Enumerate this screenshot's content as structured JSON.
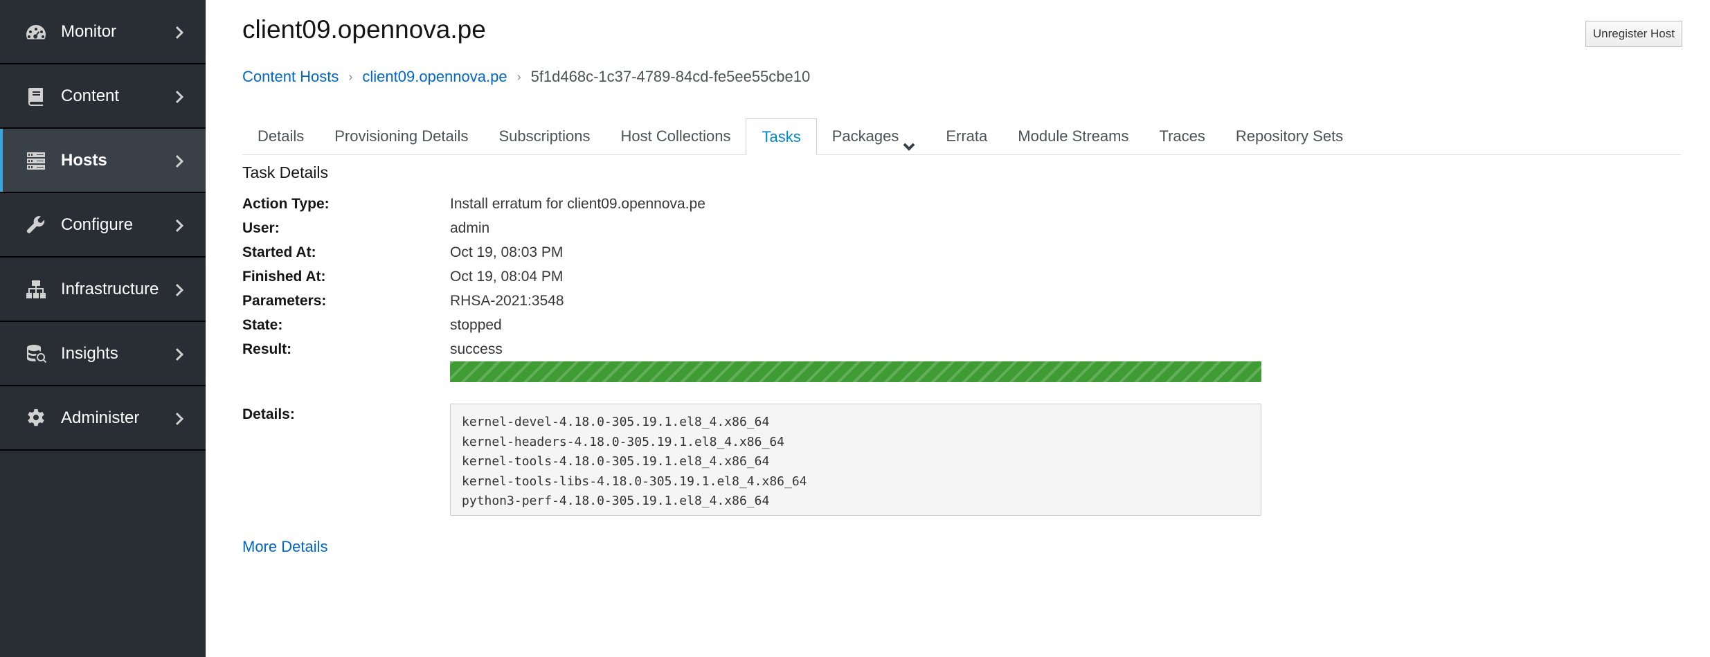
{
  "sidebar": {
    "items": [
      {
        "label": "Monitor",
        "icon": "dashboard-icon",
        "active": false
      },
      {
        "label": "Content",
        "icon": "book-icon",
        "active": false
      },
      {
        "label": "Hosts",
        "icon": "server-icon",
        "active": true
      },
      {
        "label": "Configure",
        "icon": "wrench-icon",
        "active": false
      },
      {
        "label": "Infrastructure",
        "icon": "network-icon",
        "active": false
      },
      {
        "label": "Insights",
        "icon": "database-search-icon",
        "active": false
      },
      {
        "label": "Administer",
        "icon": "gear-icon",
        "active": false
      }
    ]
  },
  "header": {
    "title": "client09.opennova.pe",
    "unregister_label": "Unregister Host"
  },
  "breadcrumb": {
    "items": [
      "Content Hosts",
      "client09.opennova.pe"
    ],
    "current": "5f1d468c-1c37-4789-84cd-fe5ee55cbe10"
  },
  "tabs": [
    {
      "label": "Details"
    },
    {
      "label": "Provisioning Details"
    },
    {
      "label": "Subscriptions"
    },
    {
      "label": "Host Collections"
    },
    {
      "label": "Tasks",
      "active": true
    },
    {
      "label": "Packages",
      "dropdown": true
    },
    {
      "label": "Errata"
    },
    {
      "label": "Module Streams"
    },
    {
      "label": "Traces"
    },
    {
      "label": "Repository Sets"
    }
  ],
  "task": {
    "section_title": "Task Details",
    "fields": [
      {
        "label": "Action Type:",
        "value": "Install erratum for client09.opennova.pe"
      },
      {
        "label": "User:",
        "value": "admin"
      },
      {
        "label": "Started At:",
        "value": "Oct 19, 08:03 PM"
      },
      {
        "label": "Finished At:",
        "value": "Oct 19, 08:04 PM"
      },
      {
        "label": "Parameters:",
        "value": "RHSA-2021:3548"
      },
      {
        "label": "State:",
        "value": "stopped"
      },
      {
        "label": "Result:",
        "value": "success"
      }
    ],
    "progress_percent": 100,
    "progress_color": "#3f9c35",
    "details_label": "Details:",
    "details_lines": [
      "kernel-devel-4.18.0-305.19.1.el8_4.x86_64",
      "kernel-headers-4.18.0-305.19.1.el8_4.x86_64",
      "kernel-tools-4.18.0-305.19.1.el8_4.x86_64",
      "kernel-tools-libs-4.18.0-305.19.1.el8_4.x86_64",
      "python3-perf-4.18.0-305.19.1.el8_4.x86_64"
    ],
    "more_details_label": "More Details"
  }
}
